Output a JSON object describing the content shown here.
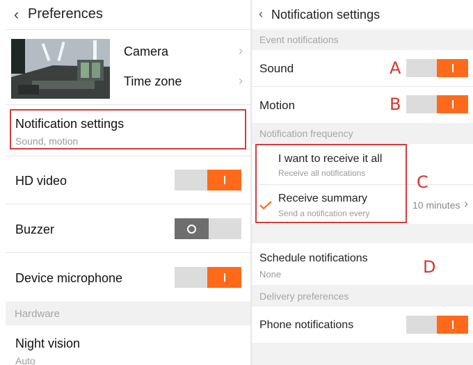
{
  "left": {
    "title": "Preferences",
    "camera_label": "Camera",
    "timezone_label": "Time zone",
    "notification": {
      "title": "Notification settings",
      "subtitle": "Sound, motion"
    },
    "hd_video": {
      "label": "HD video",
      "on": true
    },
    "buzzer": {
      "label": "Buzzer",
      "on": false
    },
    "microphone": {
      "label": "Device microphone",
      "on": true
    },
    "hardware_header": "Hardware",
    "night_vision": {
      "title": "Night vision",
      "value": "Auto"
    }
  },
  "right": {
    "title": "Notification settings",
    "event_header": "Event notifications",
    "sound": {
      "label": "Sound",
      "on": true
    },
    "motion": {
      "label": "Motion",
      "on": true
    },
    "frequency_header": "Notification frequency",
    "option_all": {
      "title": "I want to receive it all",
      "subtitle": "Receive all notifications"
    },
    "option_summary": {
      "title": "Receive summary",
      "subtitle": "Send a notification every",
      "interval": "10 minutes",
      "selected": true
    },
    "schedule": {
      "title": "Schedule notifications",
      "value": "None"
    },
    "delivery_header": "Delivery preferences",
    "phone": {
      "label": "Phone notifications",
      "on": true
    }
  },
  "annotations": {
    "a": "A",
    "b": "B",
    "c": "C",
    "d": "D"
  },
  "colors": {
    "accent": "#ff6a1a",
    "annotation": "#d9342b",
    "off_knob": "#6e6e6e"
  },
  "icons": {
    "back": "chevron-left-icon",
    "chevron": "chevron-right-icon",
    "check": "checkmark-icon"
  }
}
